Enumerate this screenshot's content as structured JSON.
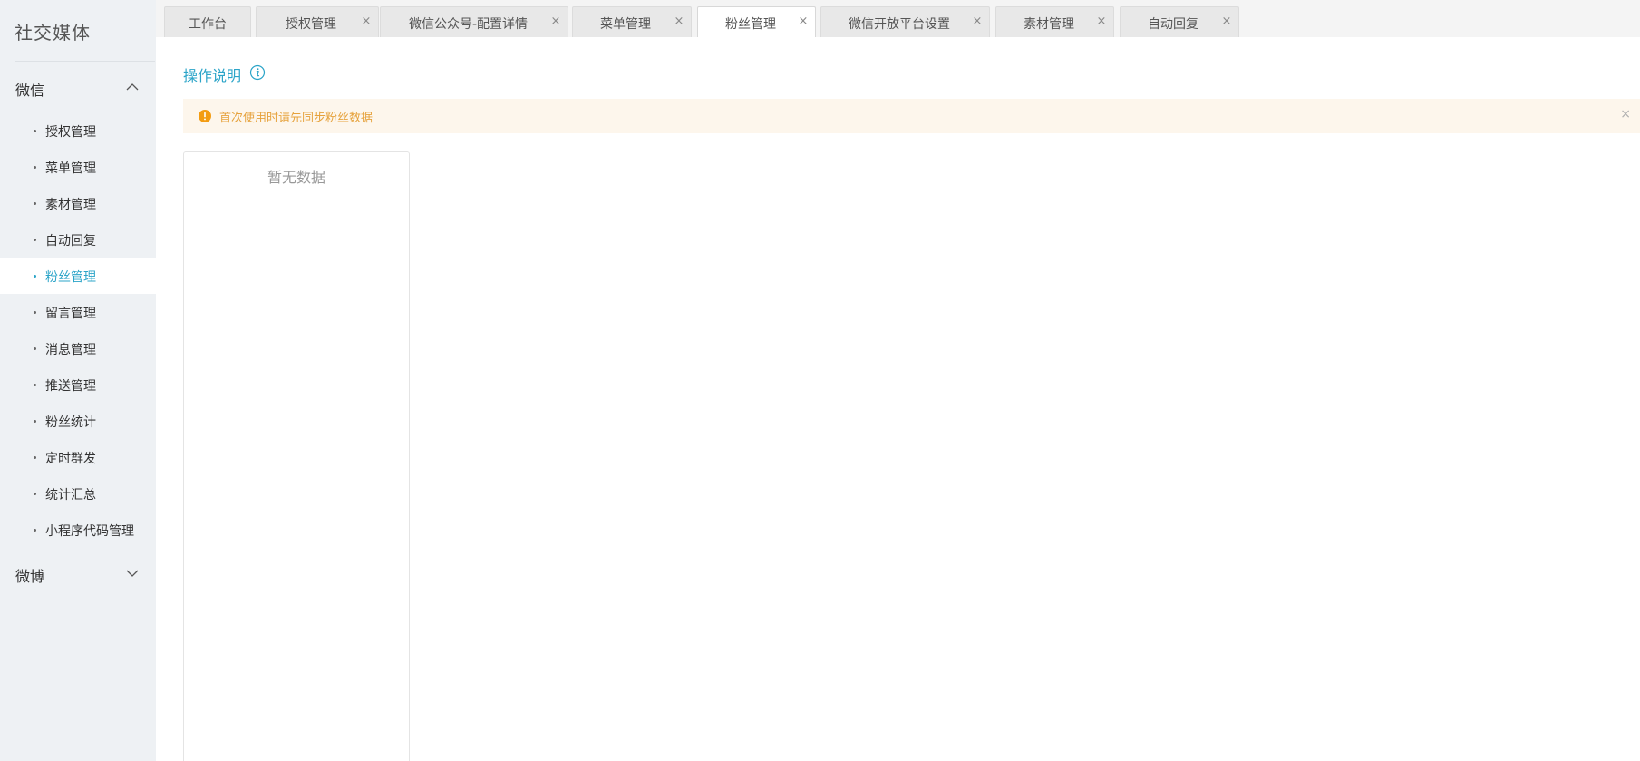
{
  "sidebar": {
    "title": "社交媒体",
    "groups": [
      {
        "label": "微信",
        "expanded": true,
        "items": [
          {
            "label": "授权管理"
          },
          {
            "label": "菜单管理"
          },
          {
            "label": "素材管理"
          },
          {
            "label": "自动回复"
          },
          {
            "label": "粉丝管理",
            "active": true
          },
          {
            "label": "留言管理"
          },
          {
            "label": "消息管理"
          },
          {
            "label": "推送管理"
          },
          {
            "label": "粉丝统计"
          },
          {
            "label": "定时群发"
          },
          {
            "label": "统计汇总"
          },
          {
            "label": "小程序代码管理"
          }
        ]
      },
      {
        "label": "微博",
        "expanded": false
      }
    ]
  },
  "tabs": [
    {
      "label": "工作台",
      "closable": false
    },
    {
      "label": "授权管理",
      "closable": true
    },
    {
      "label": "微信公众号-配置详情",
      "closable": true
    },
    {
      "label": "菜单管理",
      "closable": true
    },
    {
      "label": "粉丝管理",
      "closable": true,
      "active": true
    },
    {
      "label": "微信开放平台设置",
      "closable": true
    },
    {
      "label": "素材管理",
      "closable": true
    },
    {
      "label": "自动回复",
      "closable": true
    }
  ],
  "main": {
    "op_title": "操作说明",
    "alert_text": "首次使用时请先同步粉丝数据",
    "close_glyph": "×",
    "empty_text": "暂无数据"
  },
  "colors": {
    "accent": "#2ba4c8",
    "warning": "#e6a23c",
    "alert_bg": "#fdf6ec",
    "sidebar_bg": "#eef1f4"
  }
}
